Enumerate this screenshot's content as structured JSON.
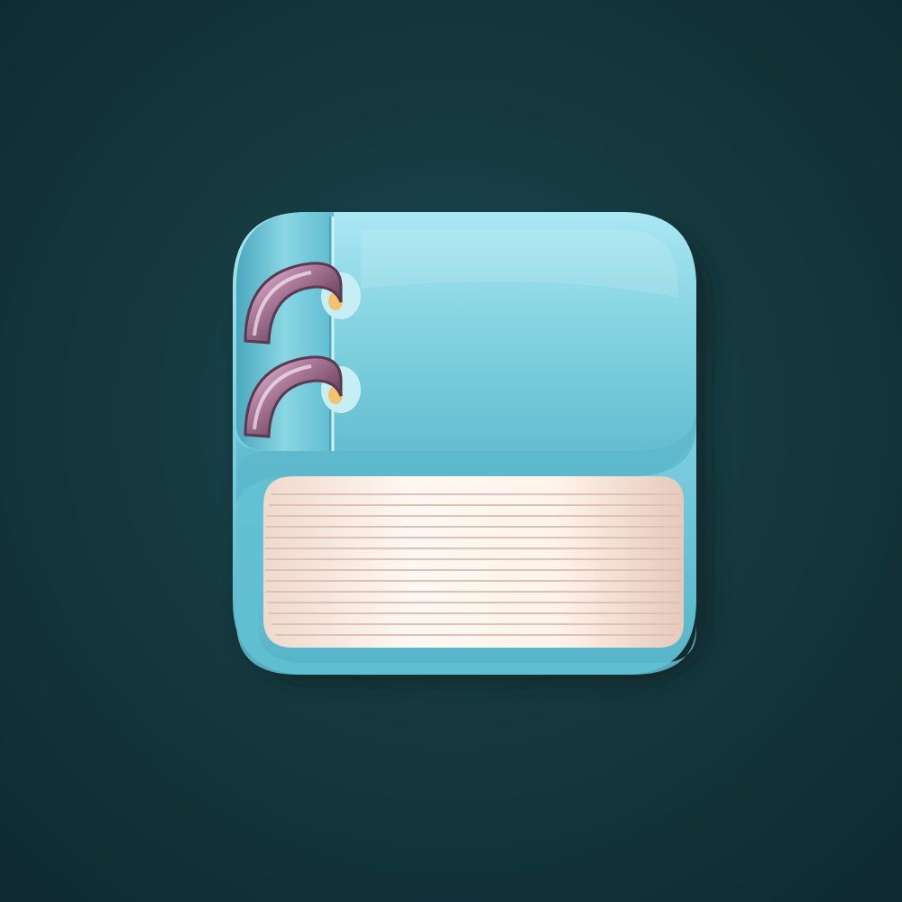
{
  "scene": {
    "subject": "notebook-app-icon",
    "background_color": "#15393f",
    "cover_color": "#7fd0df",
    "cover_highlight": "#b5eef7",
    "cover_shadow": "#3f9fb5",
    "pages_color": "#fbeee6",
    "page_line_color": "#e2c7bb",
    "ring_color": "#8a5f7a",
    "ring_highlight": "#f4d2ee",
    "ring_count": 2
  }
}
